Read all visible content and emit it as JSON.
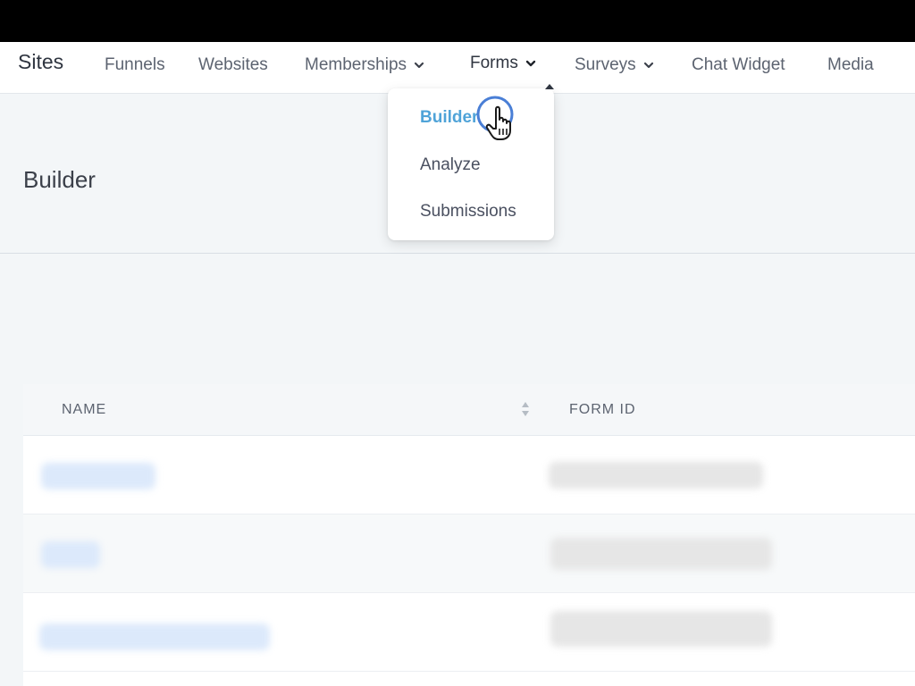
{
  "nav": {
    "brand": "Sites",
    "items": [
      {
        "label": "Funnels",
        "has_dropdown": false
      },
      {
        "label": "Websites",
        "has_dropdown": false
      },
      {
        "label": "Memberships",
        "has_dropdown": true
      },
      {
        "label": "Forms",
        "has_dropdown": true,
        "active": true
      },
      {
        "label": "Surveys",
        "has_dropdown": true
      },
      {
        "label": "Chat Widget",
        "has_dropdown": false
      },
      {
        "label": "Media",
        "has_dropdown": false
      }
    ]
  },
  "dropdown": {
    "items": [
      {
        "label": "Builder",
        "active": true
      },
      {
        "label": "Analyze",
        "active": false
      },
      {
        "label": "Submissions",
        "active": false
      }
    ]
  },
  "page": {
    "title": "Builder"
  },
  "table": {
    "columns": [
      "NAME",
      "FORM ID"
    ],
    "rows": 3
  },
  "colors": {
    "accent": "#4fa3d8",
    "cursor_ring": "#4a7fd6"
  },
  "icons": [
    "chevron-down-icon",
    "sort-icon",
    "hand-pointer-cursor-icon"
  ]
}
